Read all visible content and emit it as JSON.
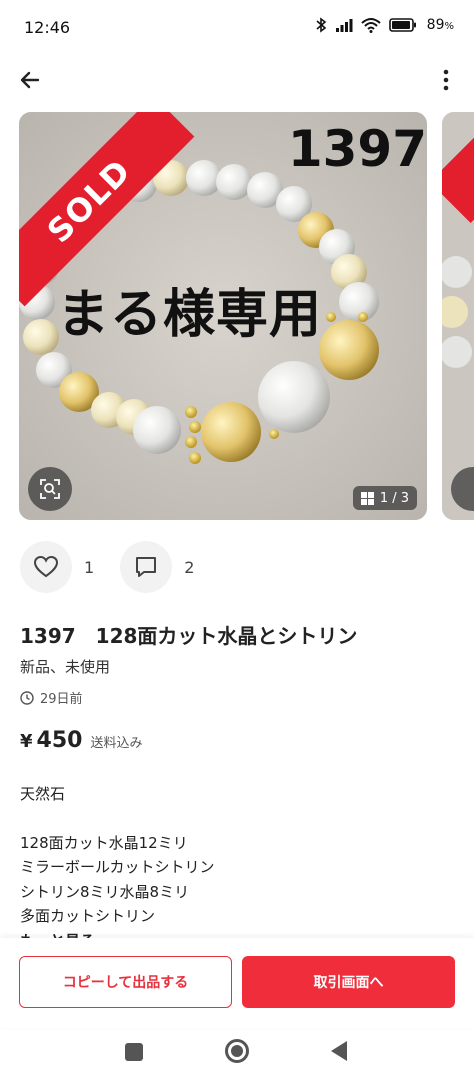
{
  "status_bar": {
    "time": "12:46",
    "battery": "89",
    "icons": [
      "bluetooth-icon",
      "signal-icon",
      "wifi-icon",
      "battery-icon"
    ]
  },
  "header": {
    "back_icon": "arrow-left-icon",
    "more_icon": "more-vertical-icon"
  },
  "gallery": {
    "sold_label": "SOLD",
    "overlay_number": "1397",
    "overlay_caption": "まる様専用",
    "page_indicator": "1 / 3",
    "scan_icon": "image-search-icon",
    "grid_icon": "grid-icon"
  },
  "engagement": {
    "likes": "1",
    "comments": "2"
  },
  "item": {
    "title": "1397　128面カット水晶とシトリン",
    "condition": "新品、未使用",
    "posted": "29日前",
    "currency": "¥",
    "price": "450",
    "shipping": "送料込み"
  },
  "description": {
    "line1": "天然石",
    "line2": "128面カット水晶12ミリ",
    "line3": "ミラーボールカットシトリン",
    "line4": "シトリン8ミリ水晶8ミリ",
    "line5": "多面カットシトリン",
    "line6": "もっと見る"
  },
  "bottom_bar": {
    "copy_button": "コピーして出品する",
    "trade_button": "取引画面へ"
  },
  "colors": {
    "accent": "#ef2d3b",
    "sold_band": "#e31f2e"
  }
}
